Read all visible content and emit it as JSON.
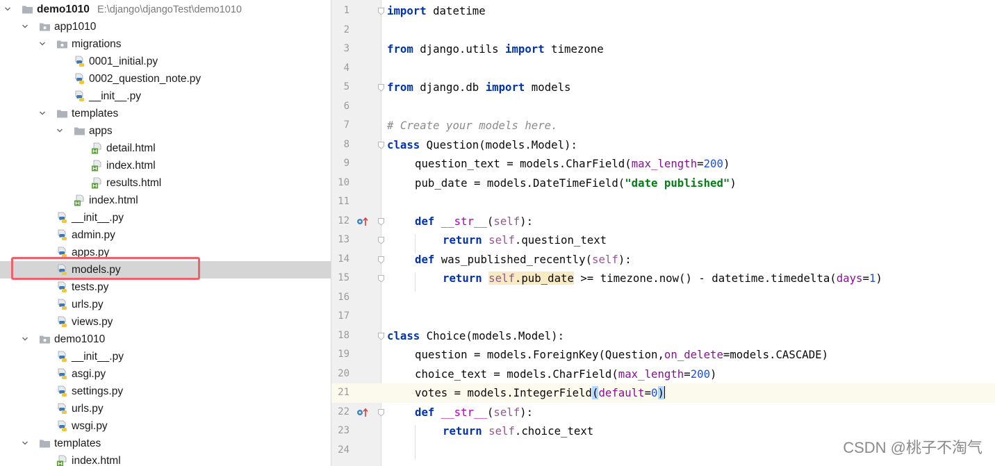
{
  "project_tree": {
    "project_name": "demo1010",
    "project_path": "E:\\django\\djangoTest\\demo1010",
    "nodes": [
      {
        "label": "app1010"
      },
      {
        "label": "migrations"
      },
      {
        "label": "0001_initial.py"
      },
      {
        "label": "0002_question_note.py"
      },
      {
        "label": "__init__.py"
      },
      {
        "label": "templates"
      },
      {
        "label": "apps"
      },
      {
        "label": "detail.html"
      },
      {
        "label": "index.html"
      },
      {
        "label": "results.html"
      },
      {
        "label": "index.html"
      },
      {
        "label": "__init__.py"
      },
      {
        "label": "admin.py"
      },
      {
        "label": "apps.py"
      },
      {
        "label": "models.py"
      },
      {
        "label": "tests.py"
      },
      {
        "label": "urls.py"
      },
      {
        "label": "views.py"
      },
      {
        "label": "demo1010"
      },
      {
        "label": "__init__.py"
      },
      {
        "label": "asgi.py"
      },
      {
        "label": "settings.py"
      },
      {
        "label": "urls.py"
      },
      {
        "label": "wsgi.py"
      },
      {
        "label": "templates"
      },
      {
        "label": "index.html"
      }
    ],
    "selected": "models.py"
  },
  "editor": {
    "file": "models.py",
    "current_line": 21,
    "lines": [
      {
        "n": "1"
      },
      {
        "n": "2"
      },
      {
        "n": "3"
      },
      {
        "n": "4"
      },
      {
        "n": "5"
      },
      {
        "n": "6"
      },
      {
        "n": "7"
      },
      {
        "n": "8"
      },
      {
        "n": "9"
      },
      {
        "n": "10"
      },
      {
        "n": "11"
      },
      {
        "n": "12"
      },
      {
        "n": "13"
      },
      {
        "n": "14"
      },
      {
        "n": "15"
      },
      {
        "n": "16"
      },
      {
        "n": "17"
      },
      {
        "n": "18"
      },
      {
        "n": "19"
      },
      {
        "n": "20"
      },
      {
        "n": "21"
      },
      {
        "n": "22"
      },
      {
        "n": "23"
      },
      {
        "n": "24"
      }
    ],
    "tokens": {
      "import": "import",
      "from": "from",
      "class": "class",
      "def": "def",
      "return": "return",
      "l1_mod": " datetime",
      "l3_mod": " django.utils ",
      "l3_name": " timezone",
      "l5_mod": " django.db ",
      "l5_name": " models",
      "l7_comment": "# Create your models here.",
      "l8_rest": " Question(models.Model):",
      "l9_a": "question_text = models.CharField(",
      "l9_param": "max_length",
      "l9_eq": "=",
      "l9_num": "200",
      "l9_close": ")",
      "l10_a": "pub_date = models.DateTimeField(",
      "l10_str": "\"date published\"",
      "l10_close": ")",
      "l12_str": "__str__",
      "l12_open": "(",
      "l12_self": "self",
      "l12_close": "):",
      "l13_self": "self",
      "l13_rest": ".question_text",
      "l14_name": " was_published_recently(",
      "l14_self": "self",
      "l14_close": "):",
      "l15_self": "self",
      "l15_attr": ".pub_date",
      "l15_rest": " >= timezone.now() - datetime.timedelta(",
      "l15_param": "days",
      "l15_eq": "=",
      "l15_num": "1",
      "l15_close": ")",
      "l18_rest": " Choice(models.Model):",
      "l19_a": "question = models.ForeignKey(Question,",
      "l19_param": "on_delete",
      "l19_rest": "=models.CASCADE)",
      "l20_a": "choice_text = models.CharField(",
      "l20_param": "max_length",
      "l20_eq": "=",
      "l20_num": "200",
      "l20_close": ")",
      "l21_a": "votes = models.IntegerField",
      "l21_open": "(",
      "l21_param": "default",
      "l21_eq": "=",
      "l21_num": "0",
      "l21_close": ")",
      "l22_str": "__str__",
      "l22_open": "(",
      "l22_self": "self",
      "l22_close": "):",
      "l23_self": "self",
      "l23_rest": ".choice_text"
    }
  },
  "watermark": "CSDN @桃子不淘气",
  "colors": {
    "keyword": "#0033b3",
    "string": "#067d17",
    "number": "#1750eb",
    "param": "#871094",
    "self": "#94558d",
    "magic": "#b200b2",
    "comment": "#8c8c8c",
    "selection_box": "#f0606a"
  },
  "icons": {
    "folder": "folder-icon",
    "package": "package-folder-icon",
    "python": "python-file-icon",
    "html": "html-file-icon",
    "override": "override-method-icon",
    "fold": "fold-marker-icon"
  }
}
